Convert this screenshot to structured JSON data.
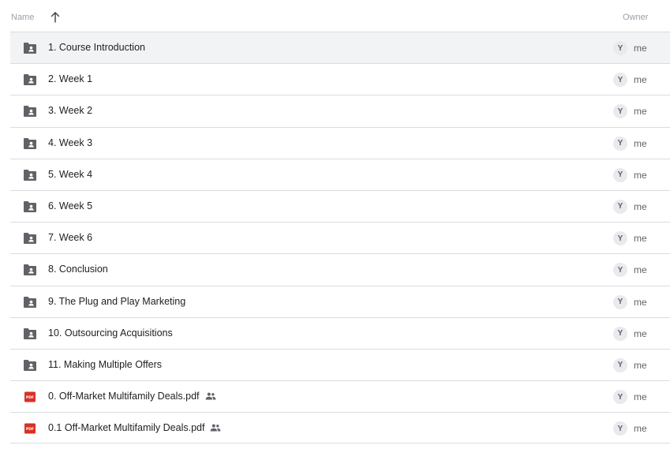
{
  "header": {
    "name_label": "Name",
    "owner_label": "Owner",
    "sort_icon": "arrow-up-icon"
  },
  "files": [
    {
      "name": "1. Course Introduction",
      "type": "shared-folder",
      "shared": false,
      "owner": "me",
      "avatar_letter": "Y",
      "selected": true
    },
    {
      "name": "2. Week 1",
      "type": "shared-folder",
      "shared": false,
      "owner": "me",
      "avatar_letter": "Y",
      "selected": false
    },
    {
      "name": "3. Week 2",
      "type": "shared-folder",
      "shared": false,
      "owner": "me",
      "avatar_letter": "Y",
      "selected": false
    },
    {
      "name": "4. Week 3",
      "type": "shared-folder",
      "shared": false,
      "owner": "me",
      "avatar_letter": "Y",
      "selected": false
    },
    {
      "name": "5. Week 4",
      "type": "shared-folder",
      "shared": false,
      "owner": "me",
      "avatar_letter": "Y",
      "selected": false
    },
    {
      "name": "6. Week 5",
      "type": "shared-folder",
      "shared": false,
      "owner": "me",
      "avatar_letter": "Y",
      "selected": false
    },
    {
      "name": "7. Week 6",
      "type": "shared-folder",
      "shared": false,
      "owner": "me",
      "avatar_letter": "Y",
      "selected": false
    },
    {
      "name": "8. Conclusion",
      "type": "shared-folder",
      "shared": false,
      "owner": "me",
      "avatar_letter": "Y",
      "selected": false
    },
    {
      "name": "9. The Plug and Play Marketing",
      "type": "shared-folder",
      "shared": false,
      "owner": "me",
      "avatar_letter": "Y",
      "selected": false
    },
    {
      "name": "10. Outsourcing Acquisitions",
      "type": "shared-folder",
      "shared": false,
      "owner": "me",
      "avatar_letter": "Y",
      "selected": false
    },
    {
      "name": "11. Making Multiple Offers",
      "type": "shared-folder",
      "shared": false,
      "owner": "me",
      "avatar_letter": "Y",
      "selected": false
    },
    {
      "name": "0. Off-Market Multifamily Deals.pdf",
      "type": "pdf",
      "shared": true,
      "owner": "me",
      "avatar_letter": "Y",
      "selected": false
    },
    {
      "name": "0.1 Off-Market Multifamily Deals.pdf",
      "type": "pdf",
      "shared": true,
      "owner": "me",
      "avatar_letter": "Y",
      "selected": false
    }
  ],
  "icons": {
    "pdf_badge": "PDF"
  },
  "colors": {
    "folder": "#5f6368",
    "pdf": "#d93025",
    "divider": "#dadce0",
    "selected_row": "#f1f3f4"
  }
}
